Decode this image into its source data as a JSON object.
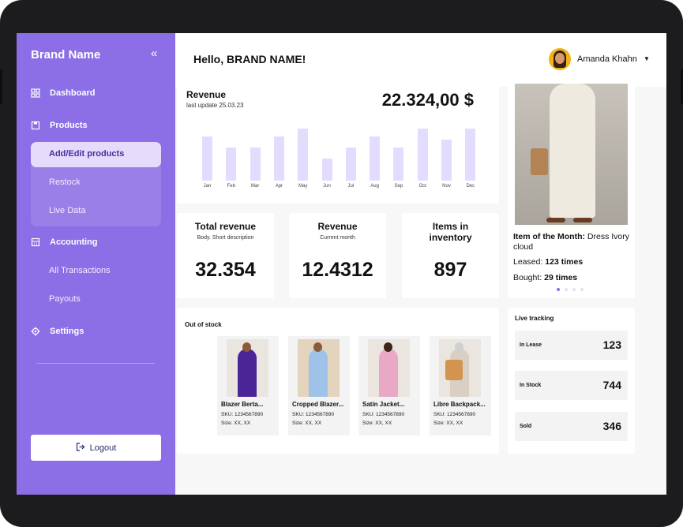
{
  "sidebar": {
    "brand": "Brand Name",
    "collapse_icon": "«",
    "items": [
      {
        "label": "Dashboard",
        "icon": "dashboard-icon"
      },
      {
        "label": "Products",
        "icon": "products-icon"
      },
      {
        "label": "Accounting",
        "icon": "accounting-icon"
      },
      {
        "label": "Settings",
        "icon": "settings-icon"
      }
    ],
    "products_sub": [
      "Add/Edit products",
      "Restock",
      "Live Data"
    ],
    "accounting_sub": [
      "All Transactions",
      "Payouts"
    ],
    "logout": "Logout"
  },
  "header": {
    "greeting": "Hello, BRAND NAME!",
    "user": "Amanda Khahn"
  },
  "revenue": {
    "title": "Revenue",
    "subtitle": "last update 25.03.23",
    "total": "22.324,00 $"
  },
  "chart_data": {
    "type": "bar",
    "categories": [
      "Jan",
      "Feb",
      "Mar",
      "Apr",
      "May",
      "Jun",
      "Jul",
      "Aug",
      "Sep",
      "Oct",
      "Nov",
      "Dec"
    ],
    "values": [
      56,
      42,
      42,
      56,
      66,
      28,
      42,
      56,
      42,
      66,
      52,
      66
    ],
    "title": "",
    "xlabel": "",
    "ylabel": "",
    "ylim": [
      0,
      70
    ],
    "colors": {
      "bar": "#e4dcff"
    }
  },
  "stats": [
    {
      "title": "Total revenue",
      "subtitle": "Body. Short description",
      "value": "32.354"
    },
    {
      "title": "Revenue",
      "subtitle": "Current month",
      "value": "12.4312"
    },
    {
      "title": "Items in inventory",
      "subtitle": "",
      "value": "897"
    }
  ],
  "item_of_month": {
    "label": "Item of the Month:",
    "name": "Dress Ivory cloud",
    "leased_label": "Leased:",
    "leased_value": "123 times",
    "bought_label": "Bought:",
    "bought_value": "29 times"
  },
  "out_of_stock": {
    "title": "Out of stock",
    "products": [
      {
        "name": "Blazer Berta...",
        "sku": "SKU: 1234567890",
        "size": "Size: XX, XX",
        "color": "#4b2596"
      },
      {
        "name": "Cropped Blazer...",
        "sku": "SKU: 1234567890",
        "size": "Size: XX, XX",
        "color": "#9fc3e8"
      },
      {
        "name": "Satin Jacket...",
        "sku": "SKU: 1234567890",
        "size": "Size: XX, XX",
        "color": "#e9a9c4"
      },
      {
        "name": "Libre Backpack...",
        "sku": "SKU: 1234567890",
        "size": "Size: XX, XX",
        "color": "#d2944f"
      }
    ]
  },
  "live_tracking": {
    "title": "Live tracking",
    "rows": [
      {
        "label": "In Lease",
        "value": "123"
      },
      {
        "label": "In Stock",
        "value": "744"
      },
      {
        "label": "Sold",
        "value": "346"
      }
    ]
  },
  "colors": {
    "accent": "#8c6ee6",
    "bar": "#e4dcff"
  }
}
